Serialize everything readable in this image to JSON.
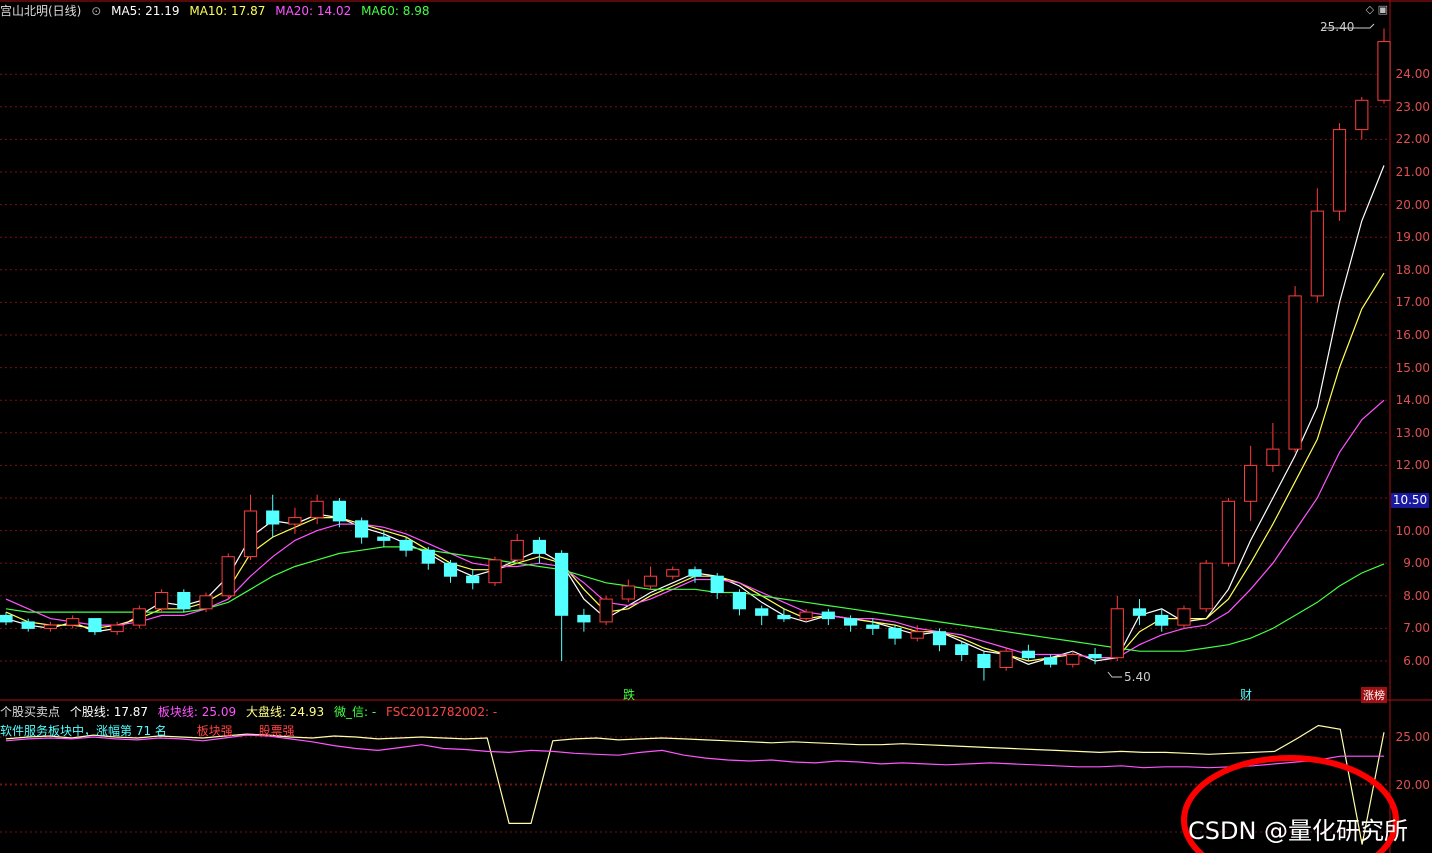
{
  "header": {
    "stock_title": "宫山北明(日线)",
    "ma5": "MA5: 21.19",
    "ma10": "MA10: 17.87",
    "ma20": "MA20: 14.02",
    "ma60": "MA60: 8.98"
  },
  "sub_header": {
    "indicator_name": "个股买卖点",
    "stock_line": "个股线: 17.87",
    "sector_line": "板块线: 25.09",
    "market_line": "大盘线: 24.93",
    "weixin": "微_信: -",
    "fsc": "FSC2012782002: -",
    "sector_desc": "软件服务板块中，涨幅第 71 名",
    "sector_strong": "板块强",
    "stock_strong": "股票强"
  },
  "markers": {
    "high_label": "25.40",
    "low_label": "5.40",
    "marker_die": "跌",
    "marker_cai": "财",
    "marker_zhangting": "涨榜",
    "current_price": "10.50"
  },
  "watermark": "CSDN @量化研究所",
  "colors": {
    "up": "#ff3c3c",
    "down": "#54ffff",
    "ma5": "#ffffff",
    "ma10": "#ffff55",
    "ma20": "#ff55ff",
    "ma60": "#44ff44",
    "grid": "#7a1010",
    "axis": "#e05050"
  },
  "chart_data": [
    {
      "type": "candlestick",
      "y_ticks": [
        "24.00",
        "23.00",
        "22.00",
        "21.00",
        "20.00",
        "19.00",
        "18.00",
        "17.00",
        "16.00",
        "15.00",
        "14.00",
        "13.00",
        "12.00",
        "11.00",
        "10.00",
        "9.00",
        "8.00",
        "7.00",
        "6.00"
      ],
      "series": [
        {
          "name": "MA5",
          "values": [
            7.3,
            7.1,
            7.0,
            7.2,
            6.9,
            7.0,
            7.4,
            7.8,
            7.7,
            7.9,
            8.6,
            9.8,
            10.3,
            10.2,
            10.5,
            10.4,
            10.1,
            9.9,
            9.6,
            9.3,
            8.9,
            8.6,
            8.8,
            9.1,
            9.4,
            9.0,
            7.9,
            7.3,
            7.7,
            8.1,
            8.4,
            8.7,
            8.6,
            8.3,
            7.8,
            7.4,
            7.2,
            7.4,
            7.3,
            7.2,
            7.0,
            6.8,
            6.9,
            6.6,
            6.3,
            6.2,
            5.9,
            6.1,
            6.3,
            6.0,
            6.1,
            7.4,
            7.6,
            7.2,
            7.3,
            8.2,
            9.7,
            11.0,
            12.3,
            13.8,
            17.0,
            19.5,
            21.2
          ]
        },
        {
          "name": "MA10",
          "values": [
            7.5,
            7.2,
            7.1,
            7.1,
            7.0,
            7.1,
            7.3,
            7.6,
            7.6,
            7.8,
            8.2,
            9.3,
            9.8,
            10.1,
            10.4,
            10.4,
            10.2,
            10.0,
            9.8,
            9.4,
            9.0,
            8.8,
            8.8,
            9.0,
            9.2,
            9.0,
            8.2,
            7.5,
            7.6,
            8.0,
            8.3,
            8.6,
            8.6,
            8.4,
            8.0,
            7.6,
            7.3,
            7.4,
            7.3,
            7.2,
            7.1,
            6.9,
            6.9,
            6.7,
            6.4,
            6.2,
            6.0,
            6.1,
            6.2,
            6.1,
            6.1,
            6.9,
            7.3,
            7.3,
            7.3,
            7.9,
            9.0,
            10.2,
            11.5,
            12.8,
            15.0,
            16.8,
            17.9
          ]
        },
        {
          "name": "MA20",
          "values": [
            7.9,
            7.6,
            7.3,
            7.2,
            7.1,
            7.1,
            7.2,
            7.4,
            7.4,
            7.6,
            7.9,
            8.6,
            9.2,
            9.7,
            10.0,
            10.2,
            10.2,
            10.1,
            9.9,
            9.6,
            9.3,
            9.0,
            8.9,
            8.9,
            9.0,
            8.9,
            8.4,
            7.8,
            7.7,
            7.9,
            8.2,
            8.5,
            8.5,
            8.4,
            8.1,
            7.8,
            7.5,
            7.4,
            7.3,
            7.3,
            7.2,
            7.0,
            6.9,
            6.8,
            6.6,
            6.4,
            6.2,
            6.2,
            6.2,
            6.1,
            6.1,
            6.5,
            6.8,
            7.0,
            7.1,
            7.5,
            8.2,
            9.0,
            10.0,
            11.0,
            12.4,
            13.4,
            14.0
          ]
        },
        {
          "name": "MA60",
          "values": [
            7.6,
            7.5,
            7.5,
            7.5,
            7.5,
            7.5,
            7.5,
            7.5,
            7.5,
            7.6,
            7.8,
            8.2,
            8.6,
            8.9,
            9.1,
            9.3,
            9.4,
            9.5,
            9.5,
            9.4,
            9.3,
            9.2,
            9.1,
            9.0,
            8.9,
            8.8,
            8.6,
            8.4,
            8.3,
            8.2,
            8.2,
            8.2,
            8.1,
            8.1,
            8.0,
            7.9,
            7.8,
            7.7,
            7.6,
            7.5,
            7.4,
            7.3,
            7.2,
            7.1,
            7.0,
            6.9,
            6.8,
            6.7,
            6.6,
            6.5,
            6.4,
            6.3,
            6.3,
            6.3,
            6.4,
            6.5,
            6.7,
            7.0,
            7.4,
            7.8,
            8.3,
            8.7,
            8.98
          ]
        }
      ],
      "candles": [
        [
          7.4,
          7.2,
          7.5,
          7.1
        ],
        [
          7.2,
          7.0,
          7.3,
          6.9
        ],
        [
          7.0,
          7.1,
          7.2,
          6.9
        ],
        [
          7.1,
          7.3,
          7.4,
          7.0
        ],
        [
          7.3,
          6.9,
          7.3,
          6.8
        ],
        [
          6.9,
          7.1,
          7.2,
          6.8
        ],
        [
          7.1,
          7.6,
          7.7,
          7.0
        ],
        [
          7.6,
          8.1,
          8.2,
          7.5
        ],
        [
          8.1,
          7.6,
          8.2,
          7.5
        ],
        [
          7.6,
          8.0,
          8.1,
          7.5
        ],
        [
          8.0,
          9.2,
          9.3,
          7.9
        ],
        [
          9.2,
          10.6,
          11.1,
          9.1
        ],
        [
          10.6,
          10.2,
          11.1,
          9.8
        ],
        [
          10.2,
          10.4,
          10.7,
          9.9
        ],
        [
          10.4,
          10.9,
          11.1,
          10.2
        ],
        [
          10.9,
          10.3,
          11.0,
          10.1
        ],
        [
          10.3,
          9.8,
          10.4,
          9.6
        ],
        [
          9.8,
          9.7,
          10.0,
          9.5
        ],
        [
          9.7,
          9.4,
          9.8,
          9.2
        ],
        [
          9.4,
          9.0,
          9.5,
          8.8
        ],
        [
          9.0,
          8.6,
          9.1,
          8.4
        ],
        [
          8.6,
          8.4,
          8.8,
          8.2
        ],
        [
          8.4,
          9.1,
          9.2,
          8.3
        ],
        [
          9.1,
          9.7,
          9.9,
          9.0
        ],
        [
          9.7,
          9.3,
          9.8,
          9.0
        ],
        [
          9.3,
          7.4,
          9.4,
          6.0
        ],
        [
          7.4,
          7.2,
          7.6,
          6.9
        ],
        [
          7.2,
          7.9,
          8.0,
          7.1
        ],
        [
          7.9,
          8.3,
          8.5,
          7.8
        ],
        [
          8.3,
          8.6,
          8.9,
          8.2
        ],
        [
          8.6,
          8.8,
          8.9,
          8.5
        ],
        [
          8.8,
          8.6,
          8.9,
          8.4
        ],
        [
          8.6,
          8.1,
          8.7,
          7.9
        ],
        [
          8.1,
          7.6,
          8.2,
          7.4
        ],
        [
          7.6,
          7.4,
          7.7,
          7.1
        ],
        [
          7.4,
          7.3,
          7.6,
          7.2
        ],
        [
          7.3,
          7.5,
          7.6,
          7.2
        ],
        [
          7.5,
          7.3,
          7.6,
          7.1
        ],
        [
          7.3,
          7.1,
          7.4,
          6.9
        ],
        [
          7.1,
          7.0,
          7.3,
          6.8
        ],
        [
          7.0,
          6.7,
          7.1,
          6.5
        ],
        [
          6.7,
          6.9,
          7.1,
          6.6
        ],
        [
          6.9,
          6.5,
          7.0,
          6.3
        ],
        [
          6.5,
          6.2,
          6.6,
          6.0
        ],
        [
          6.2,
          5.8,
          6.3,
          5.4
        ],
        [
          5.8,
          6.3,
          6.4,
          5.7
        ],
        [
          6.3,
          6.1,
          6.5,
          6.0
        ],
        [
          6.1,
          5.9,
          6.2,
          5.8
        ],
        [
          5.9,
          6.2,
          6.3,
          5.8
        ],
        [
          6.2,
          6.1,
          6.4,
          5.9
        ],
        [
          6.1,
          7.6,
          8.0,
          6.0
        ],
        [
          7.6,
          7.4,
          7.9,
          7.1
        ],
        [
          7.4,
          7.1,
          7.6,
          6.9
        ],
        [
          7.1,
          7.6,
          7.7,
          7.0
        ],
        [
          7.6,
          9.0,
          9.1,
          7.5
        ],
        [
          9.0,
          10.9,
          11.0,
          8.9
        ],
        [
          10.9,
          12.0,
          12.6,
          10.3
        ],
        [
          12.0,
          12.5,
          13.3,
          11.8
        ],
        [
          12.5,
          17.2,
          17.5,
          12.4
        ],
        [
          17.2,
          19.8,
          20.5,
          17.0
        ],
        [
          19.8,
          22.3,
          22.5,
          19.5
        ],
        [
          22.3,
          23.2,
          23.3,
          22.0
        ],
        [
          23.2,
          25.0,
          25.4,
          23.1
        ]
      ]
    },
    {
      "type": "line",
      "y_ticks": [
        "25.00",
        "20.00"
      ],
      "series": [
        {
          "name": "个股线",
          "values": [
            24.8,
            25.0,
            25.1,
            24.9,
            25.2,
            25.0,
            24.9,
            25.1,
            25.0,
            24.9,
            25.1,
            25.3,
            25.2,
            25.0,
            24.9,
            25.1,
            25.0,
            24.8,
            24.9,
            25.0,
            24.9,
            24.8,
            24.9,
            16.0,
            16.0,
            24.6,
            24.8,
            24.9,
            24.7,
            24.8,
            24.9,
            24.8,
            24.7,
            24.6,
            24.5,
            24.4,
            24.5,
            24.4,
            24.3,
            24.2,
            24.2,
            24.3,
            24.2,
            24.1,
            24.0,
            23.9,
            23.8,
            23.7,
            23.6,
            23.5,
            23.4,
            23.5,
            23.4,
            23.4,
            23.3,
            23.2,
            23.3,
            23.4,
            23.5,
            24.8,
            26.2,
            25.8,
            13.8,
            25.5
          ]
        },
        {
          "name": "板块线",
          "values": [
            24.6,
            24.8,
            24.9,
            24.8,
            25.0,
            24.8,
            24.7,
            24.9,
            24.8,
            24.6,
            24.9,
            25.2,
            25.1,
            24.8,
            24.5,
            24.1,
            23.8,
            23.6,
            23.9,
            24.2,
            23.8,
            23.7,
            23.5,
            23.4,
            23.6,
            23.5,
            23.3,
            23.2,
            23.1,
            23.4,
            23.6,
            23.1,
            22.8,
            22.6,
            22.5,
            22.6,
            22.4,
            22.3,
            22.5,
            22.4,
            22.2,
            22.3,
            22.2,
            22.1,
            22.2,
            22.3,
            22.2,
            22.1,
            22.0,
            21.9,
            21.9,
            22.0,
            21.8,
            21.9,
            21.9,
            21.8,
            21.9,
            22.0,
            22.2,
            22.4,
            22.6,
            23.0,
            23.0,
            23.0
          ]
        }
      ]
    }
  ]
}
